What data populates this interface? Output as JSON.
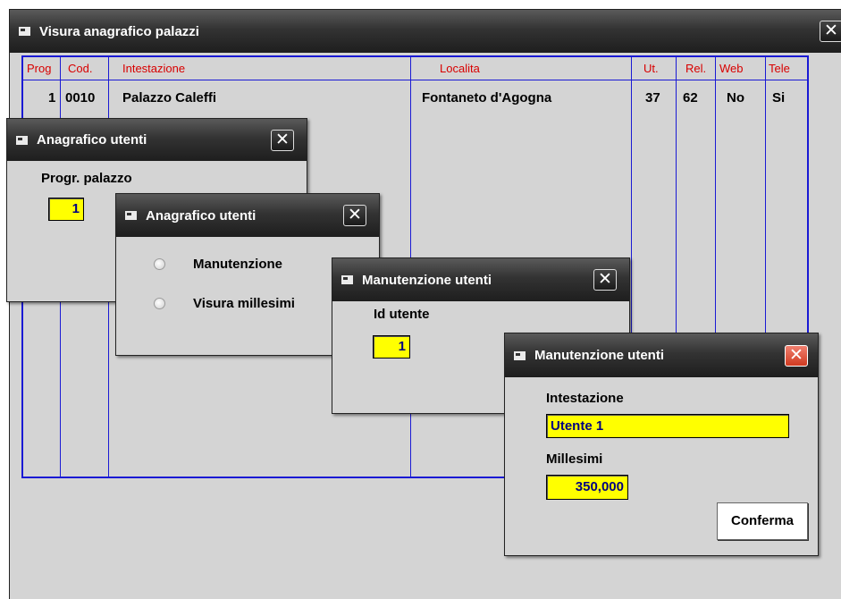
{
  "main": {
    "title": "Visura anagrafico palazzi",
    "columns": [
      "Prog",
      "Cod.",
      "Intestazione",
      "Localita",
      "Ut.",
      "Rel.",
      "Web",
      "Tele"
    ],
    "row": [
      "1",
      "0010",
      "Palazzo Caleffi",
      "Fontaneto d'Agogna",
      "37",
      "62",
      "No",
      "Si"
    ]
  },
  "dialog1": {
    "title": "Anagrafico utenti",
    "label": "Progr. palazzo",
    "value": "1"
  },
  "dialog2": {
    "title": "Anagrafico utenti",
    "options": [
      "Manutenzione",
      "Visura millesimi"
    ]
  },
  "dialog3": {
    "title": "Manutenzione utenti",
    "label": "Id utente",
    "value": "1"
  },
  "dialog4": {
    "title": "Manutenzione utenti",
    "intestazione_label": "Intestazione",
    "intestazione_value": "Utente 1",
    "millesimi_label": "Millesimi",
    "millesimi_value": "350,000",
    "confirm_label": "Conferma"
  },
  "icons": {
    "window_icon": "window-icon",
    "close": "close-icon",
    "close_glyph": "✕"
  },
  "colors": {
    "grid_line": "#1a1ad4",
    "header_text": "#d80000",
    "field_background": "#ffff00",
    "field_text": "#000080",
    "close_active": "#d03a20"
  }
}
